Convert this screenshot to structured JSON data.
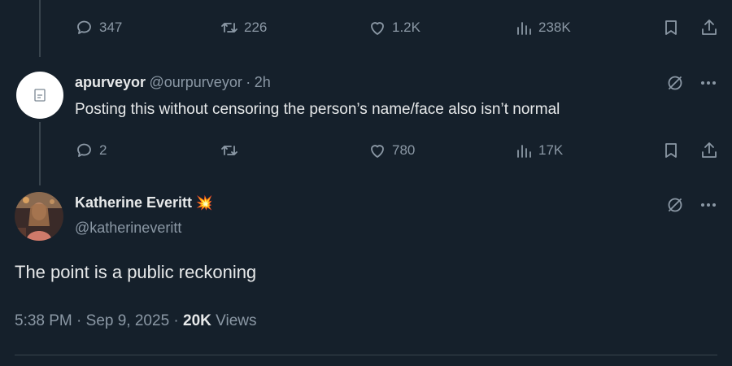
{
  "top_tweet": {
    "replies": "347",
    "reposts": "226",
    "likes": "1.2K",
    "views": "238K"
  },
  "reply": {
    "display_name": "apurveyor",
    "handle": "@ourpurveyor",
    "separator": "·",
    "time": "2h",
    "text": "Posting this without censoring the person’s name/face also isn’t normal",
    "replies": "2",
    "reposts": "",
    "likes": "780",
    "views": "17K"
  },
  "main_tweet": {
    "display_name": "Katherine Everitt",
    "name_emoji": "💥",
    "handle": "@katherineveritt",
    "text": "The point is a public reckoning",
    "time": "5:38 PM",
    "sep1": "·",
    "date": "Sep 9, 2025",
    "sep2": "·",
    "views_count": "20K",
    "views_label": "Views"
  }
}
